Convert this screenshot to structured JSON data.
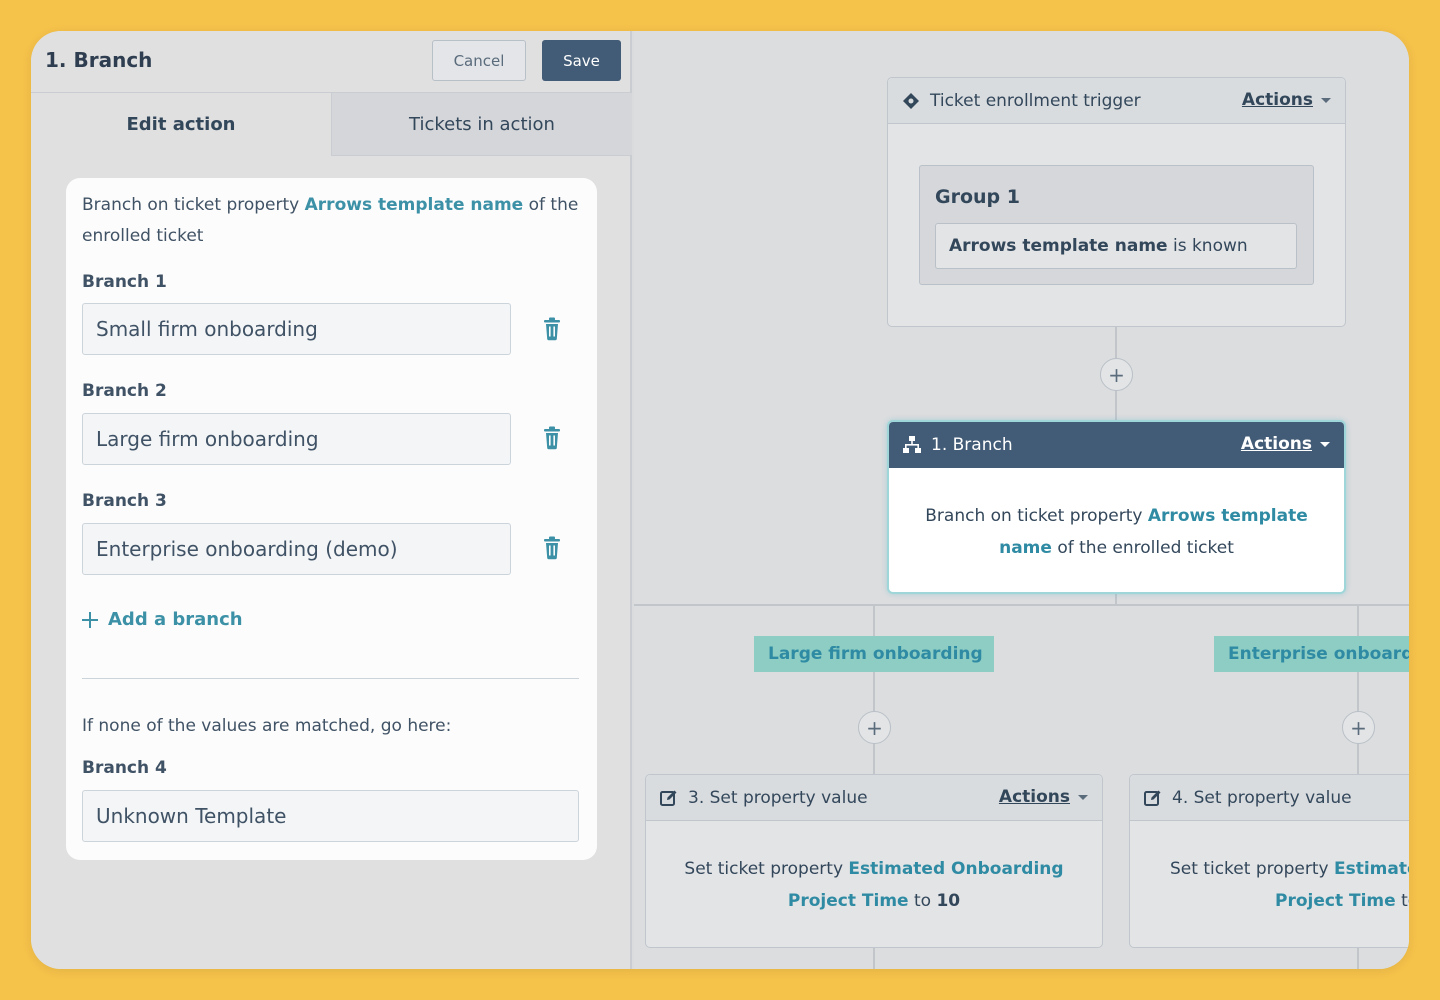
{
  "panel": {
    "title": "1. Branch",
    "cancel_label": "Cancel",
    "save_label": "Save",
    "tabs": [
      {
        "label": "Edit action",
        "active": true
      },
      {
        "label": "Tickets in action",
        "active": false
      }
    ],
    "description": {
      "prefix": "Branch on ticket property ",
      "property": "Arrows template name",
      "suffix": " of the enrolled ticket"
    },
    "branches": [
      {
        "label": "Branch 1",
        "value": "Small firm onboarding"
      },
      {
        "label": "Branch 2",
        "value": "Large firm onboarding"
      },
      {
        "label": "Branch 3",
        "value": "Enterprise onboarding (demo)"
      }
    ],
    "add_branch_label": "Add a branch",
    "fallback_text": "If none of the values are matched, go here:",
    "fallback_branch": {
      "label": "Branch 4",
      "value": "Unknown Template"
    }
  },
  "canvas": {
    "trigger": {
      "title": "Ticket enrollment trigger",
      "actions_label": "Actions",
      "group_title": "Group 1",
      "condition_property": "Arrows template name",
      "condition_operator": " is known"
    },
    "branch_node": {
      "title": "1. Branch",
      "actions_label": "Actions",
      "body_prefix": "Branch on ticket property ",
      "body_property_line1": "Arrows template",
      "body_property_line2": "name",
      "body_suffix": " of the enrolled ticket"
    },
    "branch_labels": [
      "Large firm onboarding",
      "Enterprise onboarding"
    ],
    "set_nodes": [
      {
        "title": "3. Set property value",
        "actions_label": "Actions",
        "prefix": "Set ticket property ",
        "property_line1": "Estimated Onboarding",
        "property_line2": "Project Time",
        "to": " to ",
        "value": "10"
      },
      {
        "title": "4. Set property value",
        "prefix": "Set ticket property ",
        "property_line1": "Estimated Onboarding",
        "property_line2": "Project Time",
        "to": " to "
      }
    ]
  },
  "colors": {
    "background": "#f5c24a",
    "primary_dark": "#425b76",
    "link_teal": "#2f8ba3",
    "branch_label_bg": "#8ecdc4",
    "text": "#33475b"
  },
  "icons": [
    "trash-icon",
    "plus-icon",
    "diamond-trigger-icon",
    "branch-tree-icon",
    "edit-property-icon",
    "caret-down-icon"
  ]
}
